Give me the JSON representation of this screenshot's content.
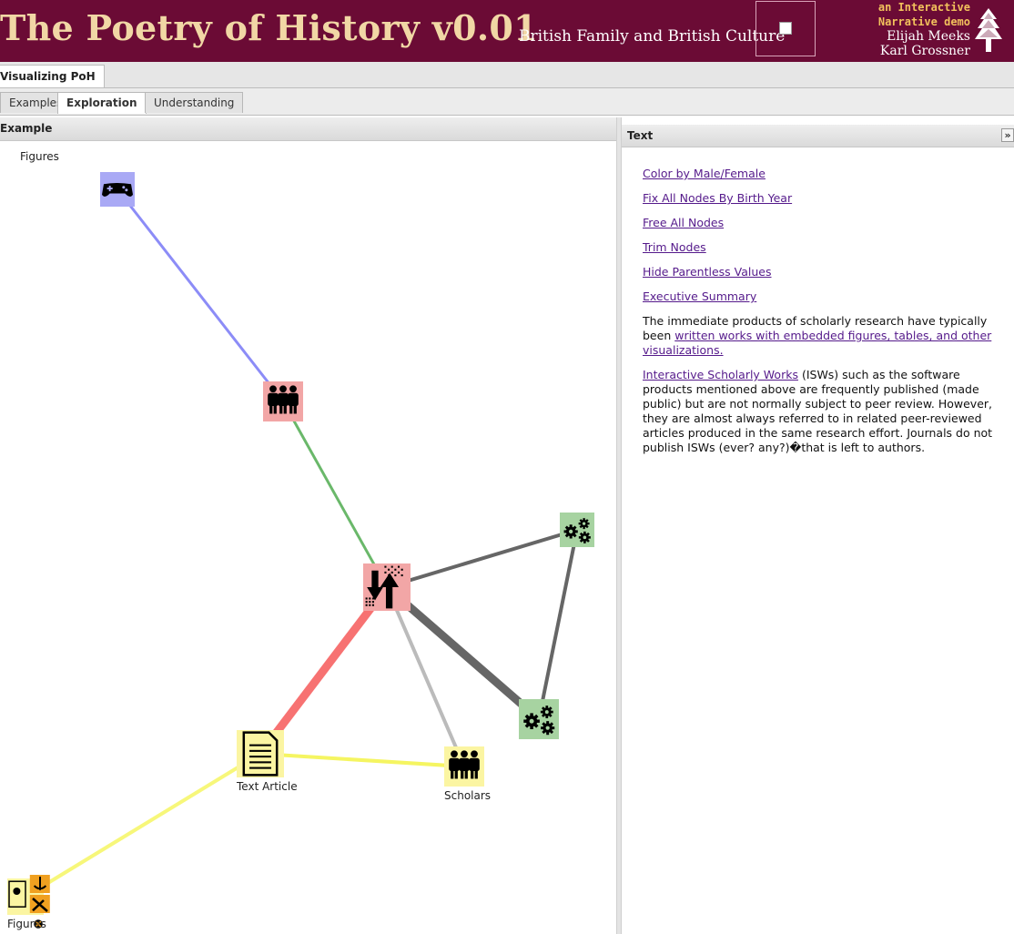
{
  "header": {
    "title": "The Poetry of History v0.01",
    "subtitle": "British Family and British Culture",
    "credit_line1": "an Interactive",
    "credit_line2": "Narrative demo",
    "author1": "Elijah Meeks",
    "author2": "Karl Grossner"
  },
  "top_tab": {
    "label": "Visualizing PoH"
  },
  "sub_tabs": [
    {
      "label": "Examples",
      "active": false
    },
    {
      "label": "Exploration",
      "active": true
    },
    {
      "label": "Understanding",
      "active": false
    }
  ],
  "left_panel": {
    "title": "Example",
    "caption": "Figures"
  },
  "graph": {
    "nodes": [
      {
        "id": "game",
        "icon": "gamepad-icon",
        "color": "#a9a9f5",
        "label": ""
      },
      {
        "id": "people1",
        "icon": "people-icon",
        "color": "#f2a6a6",
        "label": ""
      },
      {
        "id": "hub",
        "icon": "data-exchange-icon",
        "color": "#f2a6a6",
        "label": ""
      },
      {
        "id": "gears1",
        "icon": "gears-icon",
        "color": "#a7d3a1",
        "label": ""
      },
      {
        "id": "gears2",
        "icon": "gears-icon",
        "color": "#a7d3a1",
        "label": ""
      },
      {
        "id": "article",
        "icon": "document-icon",
        "color": "#fbf5a2",
        "label": "Text Article"
      },
      {
        "id": "scholars",
        "icon": "people-icon",
        "color": "#fbf5a2",
        "label": "Scholars"
      },
      {
        "id": "figures",
        "icon": "figures-icon",
        "color": "#fbf5a2",
        "label": "Figures"
      }
    ],
    "edges": [
      {
        "from": "game",
        "to": "people1",
        "color": "#8c8cf7"
      },
      {
        "from": "people1",
        "to": "hub",
        "color": "#6ab86a"
      },
      {
        "from": "hub",
        "to": "gears1",
        "color": "#666666"
      },
      {
        "from": "gears1",
        "to": "gears2",
        "color": "#666666"
      },
      {
        "from": "hub",
        "to": "gears2",
        "color": "#666666"
      },
      {
        "from": "hub",
        "to": "scholars",
        "color": "#bbbbbb"
      },
      {
        "from": "hub",
        "to": "article",
        "color": "#f77272"
      },
      {
        "from": "article",
        "to": "scholars",
        "color": "#f5f561"
      },
      {
        "from": "article",
        "to": "figures",
        "color": "#f7f77a"
      }
    ]
  },
  "right_panel": {
    "title": "Text",
    "collapse_label": "»",
    "links": [
      "Color by Male/Female",
      "Fix All Nodes By Birth Year",
      "Free All Nodes",
      "Trim Nodes",
      "Hide Parentless Values",
      "Executive Summary"
    ],
    "para1_text": "The immediate products of scholarly research have typically been ",
    "para1_link": "written works with embedded figures, tables, and other visualizations.",
    "para2_link": "Interactive Scholarly Works",
    "para2_text": " (ISWs) such as the software products mentioned above are frequently published (made public) but are not normally subject to peer review. However, they are almost always referred to in related peer-reviewed articles produced in the same research effort. Journals do not publish ISWs (ever? any?)�that is left to authors."
  }
}
